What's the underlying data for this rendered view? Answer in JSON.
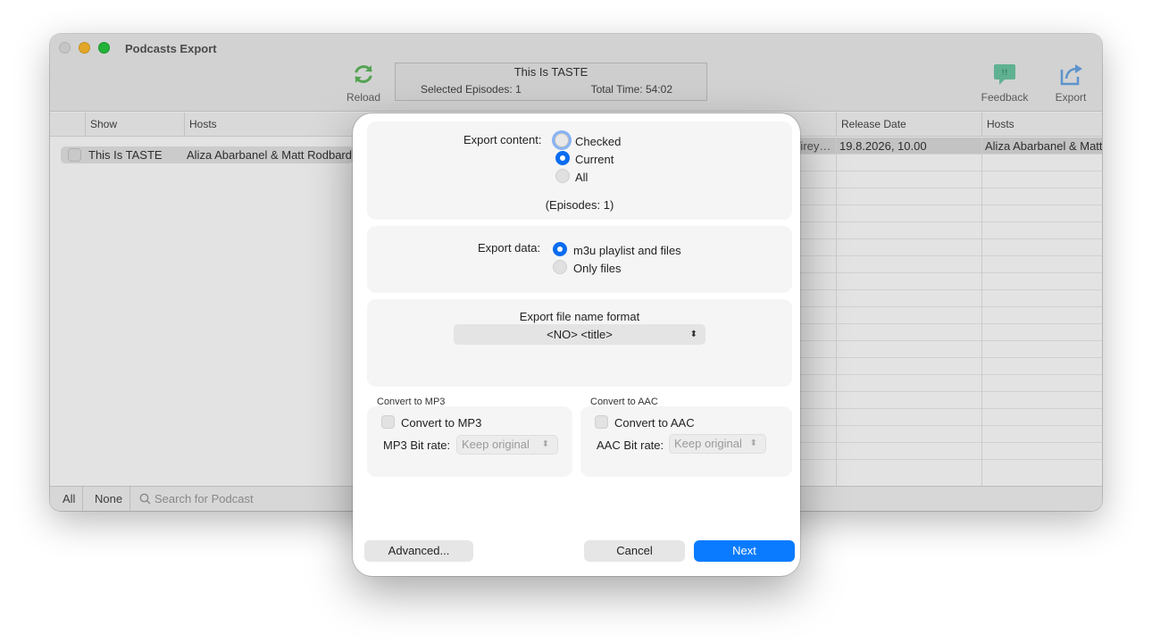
{
  "window": {
    "title": "Podcasts Export"
  },
  "toolbar": {
    "reload_label": "Reload",
    "feedback_label": "Feedback",
    "export_label": "Export",
    "info_title": "This Is TASTE",
    "selected_episodes": "Selected Episodes: 1",
    "total_time": "Total Time: 54:02"
  },
  "left_table": {
    "headers": [
      "Show",
      "Hosts"
    ],
    "rows": [
      {
        "show": "This Is TASTE",
        "hosts": "Aliza Abarbanel & Matt Rodbard"
      }
    ]
  },
  "right_table": {
    "headers": [
      "Release Date",
      "Hosts"
    ],
    "rows": [
      {
        "fragment": "Virey…",
        "release_date": "19.8.2026, 10.00",
        "hosts": "Aliza Abarbanel & Matt Rodbard"
      }
    ]
  },
  "bottom_bar": {
    "all_label": "All",
    "none_label": "None",
    "search_placeholder": "Search for Podcast"
  },
  "dialog": {
    "export_content_label": "Export content:",
    "content_options": [
      "Checked",
      "Current",
      "All"
    ],
    "content_selected": "Current",
    "episodes_count": "(Episodes: 1)",
    "export_data_label": "Export data:",
    "data_options": [
      "m3u playlist and files",
      "Only files"
    ],
    "data_selected": "m3u playlist and files",
    "file_name_format_label": "Export file name format",
    "file_name_format_value": "<NO> <title>",
    "mp3": {
      "section_title": "Convert to MP3",
      "checkbox_label": "Convert to MP3",
      "bitrate_label": "MP3 Bit rate:",
      "bitrate_value": "Keep original"
    },
    "aac": {
      "section_title": "Convert to AAC",
      "checkbox_label": "Convert to AAC",
      "bitrate_label": "AAC Bit rate:",
      "bitrate_value": "Keep original"
    },
    "advanced_button": "Advanced...",
    "cancel_button": "Cancel",
    "next_button": "Next"
  },
  "colors": {
    "accent": "#0a7bff",
    "radio_selected": "#0a6cf0",
    "traffic_min": "#febc2e",
    "traffic_max": "#28c840"
  }
}
